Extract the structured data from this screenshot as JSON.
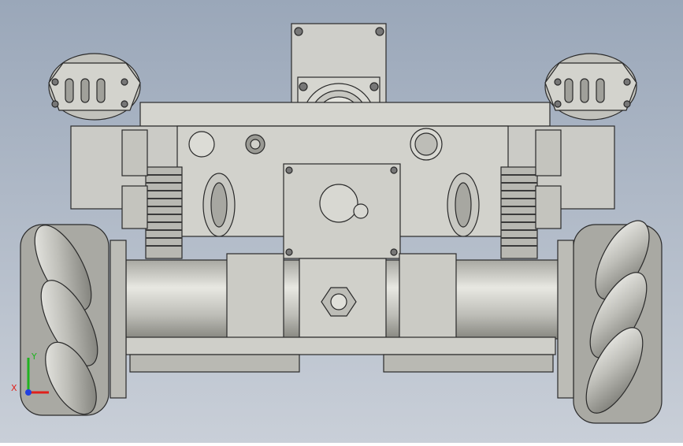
{
  "viewport": {
    "background_top": "#9aa7b9",
    "background_bottom": "#c9cfd8",
    "part_color": "#c9c9c4",
    "edge_color": "#2a2a2a"
  },
  "triad": {
    "x_label": "X",
    "y_label": "Y",
    "x_color": "#e0201b",
    "y_color": "#1fb31f",
    "z_color": "#2040e0"
  }
}
